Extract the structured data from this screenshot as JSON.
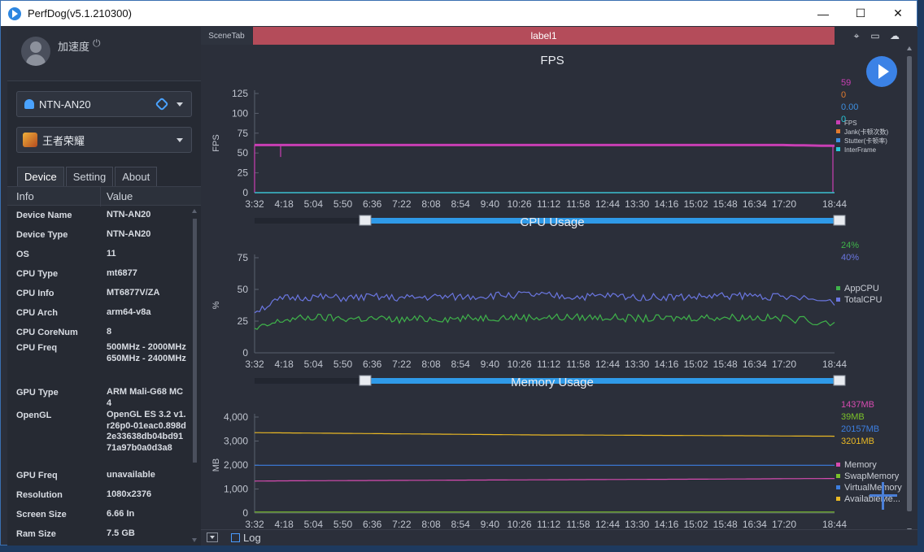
{
  "window": {
    "title": "PerfDog(v5.1.210300)",
    "minimize": "—",
    "maximize": "☐",
    "close": "✕"
  },
  "user": {
    "name": "加速度",
    "power_glyph": "⏻"
  },
  "device_select": {
    "label": "NTN-AN20"
  },
  "app_select": {
    "label": "王者荣耀"
  },
  "tabs": [
    "Device",
    "Setting",
    "About"
  ],
  "table": {
    "head": [
      "Info",
      "Value"
    ],
    "rows": [
      {
        "k": "Device Name",
        "v": "NTN-AN20"
      },
      {
        "k": "Device Type",
        "v": "NTN-AN20"
      },
      {
        "k": "OS",
        "v": "11"
      },
      {
        "k": "CPU Type",
        "v": "mt6877"
      },
      {
        "k": "CPU Info",
        "v": "MT6877V/ZA"
      },
      {
        "k": "CPU Arch",
        "v": "arm64-v8a"
      },
      {
        "k": "CPU CoreNum",
        "v": "8"
      },
      {
        "k": "CPU Freq",
        "v": "500MHz - 2000MHz 650MHz - 2400MHz"
      },
      {
        "k": "GPU Type",
        "v": "ARM Mali-G68 MC4"
      },
      {
        "k": "OpenGL",
        "v": "OpenGL ES 3.2 v1.r26p0-01eac0.898d2e33638db04bd9171a97b0a0d3a8"
      },
      {
        "k": "GPU Freq",
        "v": "unavailable"
      },
      {
        "k": "Resolution",
        "v": "1080x2376"
      },
      {
        "k": "Screen Size",
        "v": "6.66 In"
      },
      {
        "k": "Ram Size",
        "v": "7.5 GB"
      }
    ]
  },
  "scene": {
    "tab": "SceneTab",
    "label": "label1"
  },
  "bottom": {
    "log_label": "Log"
  },
  "colors": {
    "fps": "#c93fb4",
    "jank": "#e07a2e",
    "stutter": "#3d8fe0",
    "interframe": "#28c6d8",
    "appcpu": "#3fb34a",
    "totalcpu": "#6a76e0",
    "memory": "#d64bb0",
    "swap": "#7bc22a",
    "virtual": "#3d7fe0",
    "available": "#e9b824",
    "accent": "#3b82e6",
    "scene_label_bg": "#b44c5a"
  },
  "chart_data": [
    {
      "type": "line",
      "title": "FPS",
      "ylabel": "FPS",
      "ylim": [
        0,
        125
      ],
      "yticks": [
        "0",
        "25",
        "50",
        "75",
        "100",
        "125"
      ],
      "x": [
        "3:32",
        "4:18",
        "5:04",
        "5:50",
        "6:36",
        "7:22",
        "8:08",
        "8:54",
        "9:40",
        "10:26",
        "11:12",
        "11:58",
        "12:44",
        "13:30",
        "14:16",
        "15:02",
        "15:48",
        "16:34",
        "17:20",
        "18:44"
      ],
      "current_values": [
        "59",
        "0",
        "0.00",
        "0"
      ],
      "series": [
        {
          "name": "FPS",
          "values": [
            60,
            60,
            60,
            60,
            60,
            60,
            60,
            60,
            60,
            60,
            60,
            60,
            60,
            60,
            60,
            60,
            60,
            60,
            60,
            59
          ]
        },
        {
          "name": "Jank(卡顿次数)",
          "values": [
            0,
            0,
            0,
            0,
            0,
            0,
            0,
            0,
            0,
            0,
            0,
            0,
            0,
            0,
            0,
            0,
            0,
            0,
            0,
            0
          ]
        },
        {
          "name": "Stutter(卡顿率)",
          "values": [
            0,
            0,
            0,
            0,
            0,
            0,
            0,
            0,
            0,
            0,
            0,
            0,
            0,
            0,
            0,
            0,
            0,
            0,
            0,
            0
          ]
        },
        {
          "name": "InterFrame",
          "values": [
            0,
            0,
            0,
            0,
            0,
            0,
            0,
            0,
            0,
            0,
            0,
            0,
            0,
            0,
            0,
            0,
            0,
            0,
            0,
            0
          ]
        }
      ]
    },
    {
      "type": "line",
      "title": "CPU Usage",
      "ylabel": "%",
      "ylim": [
        0,
        75
      ],
      "yticks": [
        "0",
        "25",
        "50",
        "75"
      ],
      "x": [
        "3:32",
        "4:18",
        "5:04",
        "5:50",
        "6:36",
        "7:22",
        "8:08",
        "8:54",
        "9:40",
        "10:26",
        "11:12",
        "11:58",
        "12:44",
        "13:30",
        "14:16",
        "15:02",
        "15:48",
        "16:34",
        "17:20",
        "18:44"
      ],
      "current_values": [
        "24%",
        "40%"
      ],
      "series": [
        {
          "name": "AppCPU",
          "values": [
            18,
            26,
            28,
            27,
            27,
            26,
            27,
            27,
            28,
            28,
            28,
            28,
            28,
            27,
            27,
            28,
            28,
            28,
            27,
            24
          ]
        },
        {
          "name": "TotalCPU",
          "values": [
            33,
            43,
            44,
            43,
            44,
            43,
            44,
            44,
            45,
            46,
            45,
            44,
            45,
            44,
            44,
            44,
            45,
            45,
            44,
            40
          ]
        }
      ]
    },
    {
      "type": "line",
      "title": "Memory Usage",
      "ylabel": "MB",
      "ylim": [
        0,
        4000
      ],
      "yticks": [
        "0",
        "1,000",
        "2,000",
        "3,000",
        "4,000"
      ],
      "x": [
        "3:32",
        "4:18",
        "5:04",
        "5:50",
        "6:36",
        "7:22",
        "8:08",
        "8:54",
        "9:40",
        "10:26",
        "11:12",
        "11:58",
        "12:44",
        "13:30",
        "14:16",
        "15:02",
        "15:48",
        "16:34",
        "17:20",
        "18:44"
      ],
      "current_values": [
        "1437MB",
        "39MB",
        "20157MB",
        "3201MB"
      ],
      "series": [
        {
          "name": "Memory",
          "values": [
            1330,
            1340,
            1345,
            1350,
            1355,
            1360,
            1365,
            1370,
            1375,
            1380,
            1385,
            1390,
            1395,
            1400,
            1405,
            1410,
            1415,
            1420,
            1430,
            1437
          ]
        },
        {
          "name": "SwapMemory",
          "values": [
            39,
            39,
            39,
            39,
            39,
            39,
            39,
            39,
            39,
            39,
            39,
            39,
            39,
            39,
            39,
            39,
            39,
            39,
            39,
            39
          ]
        },
        {
          "name": "VirtualMemory",
          "values": [
            1990,
            1990,
            1990,
            1990,
            1990,
            1990,
            1990,
            1990,
            1990,
            1990,
            1990,
            1990,
            1990,
            1990,
            1990,
            1990,
            1990,
            1990,
            1990,
            1990
          ]
        },
        {
          "name": "AvailableMe...",
          "values": [
            3350,
            3340,
            3330,
            3320,
            3310,
            3300,
            3290,
            3280,
            3270,
            3260,
            3250,
            3250,
            3245,
            3240,
            3235,
            3230,
            3225,
            3220,
            3210,
            3201
          ]
        }
      ]
    }
  ]
}
